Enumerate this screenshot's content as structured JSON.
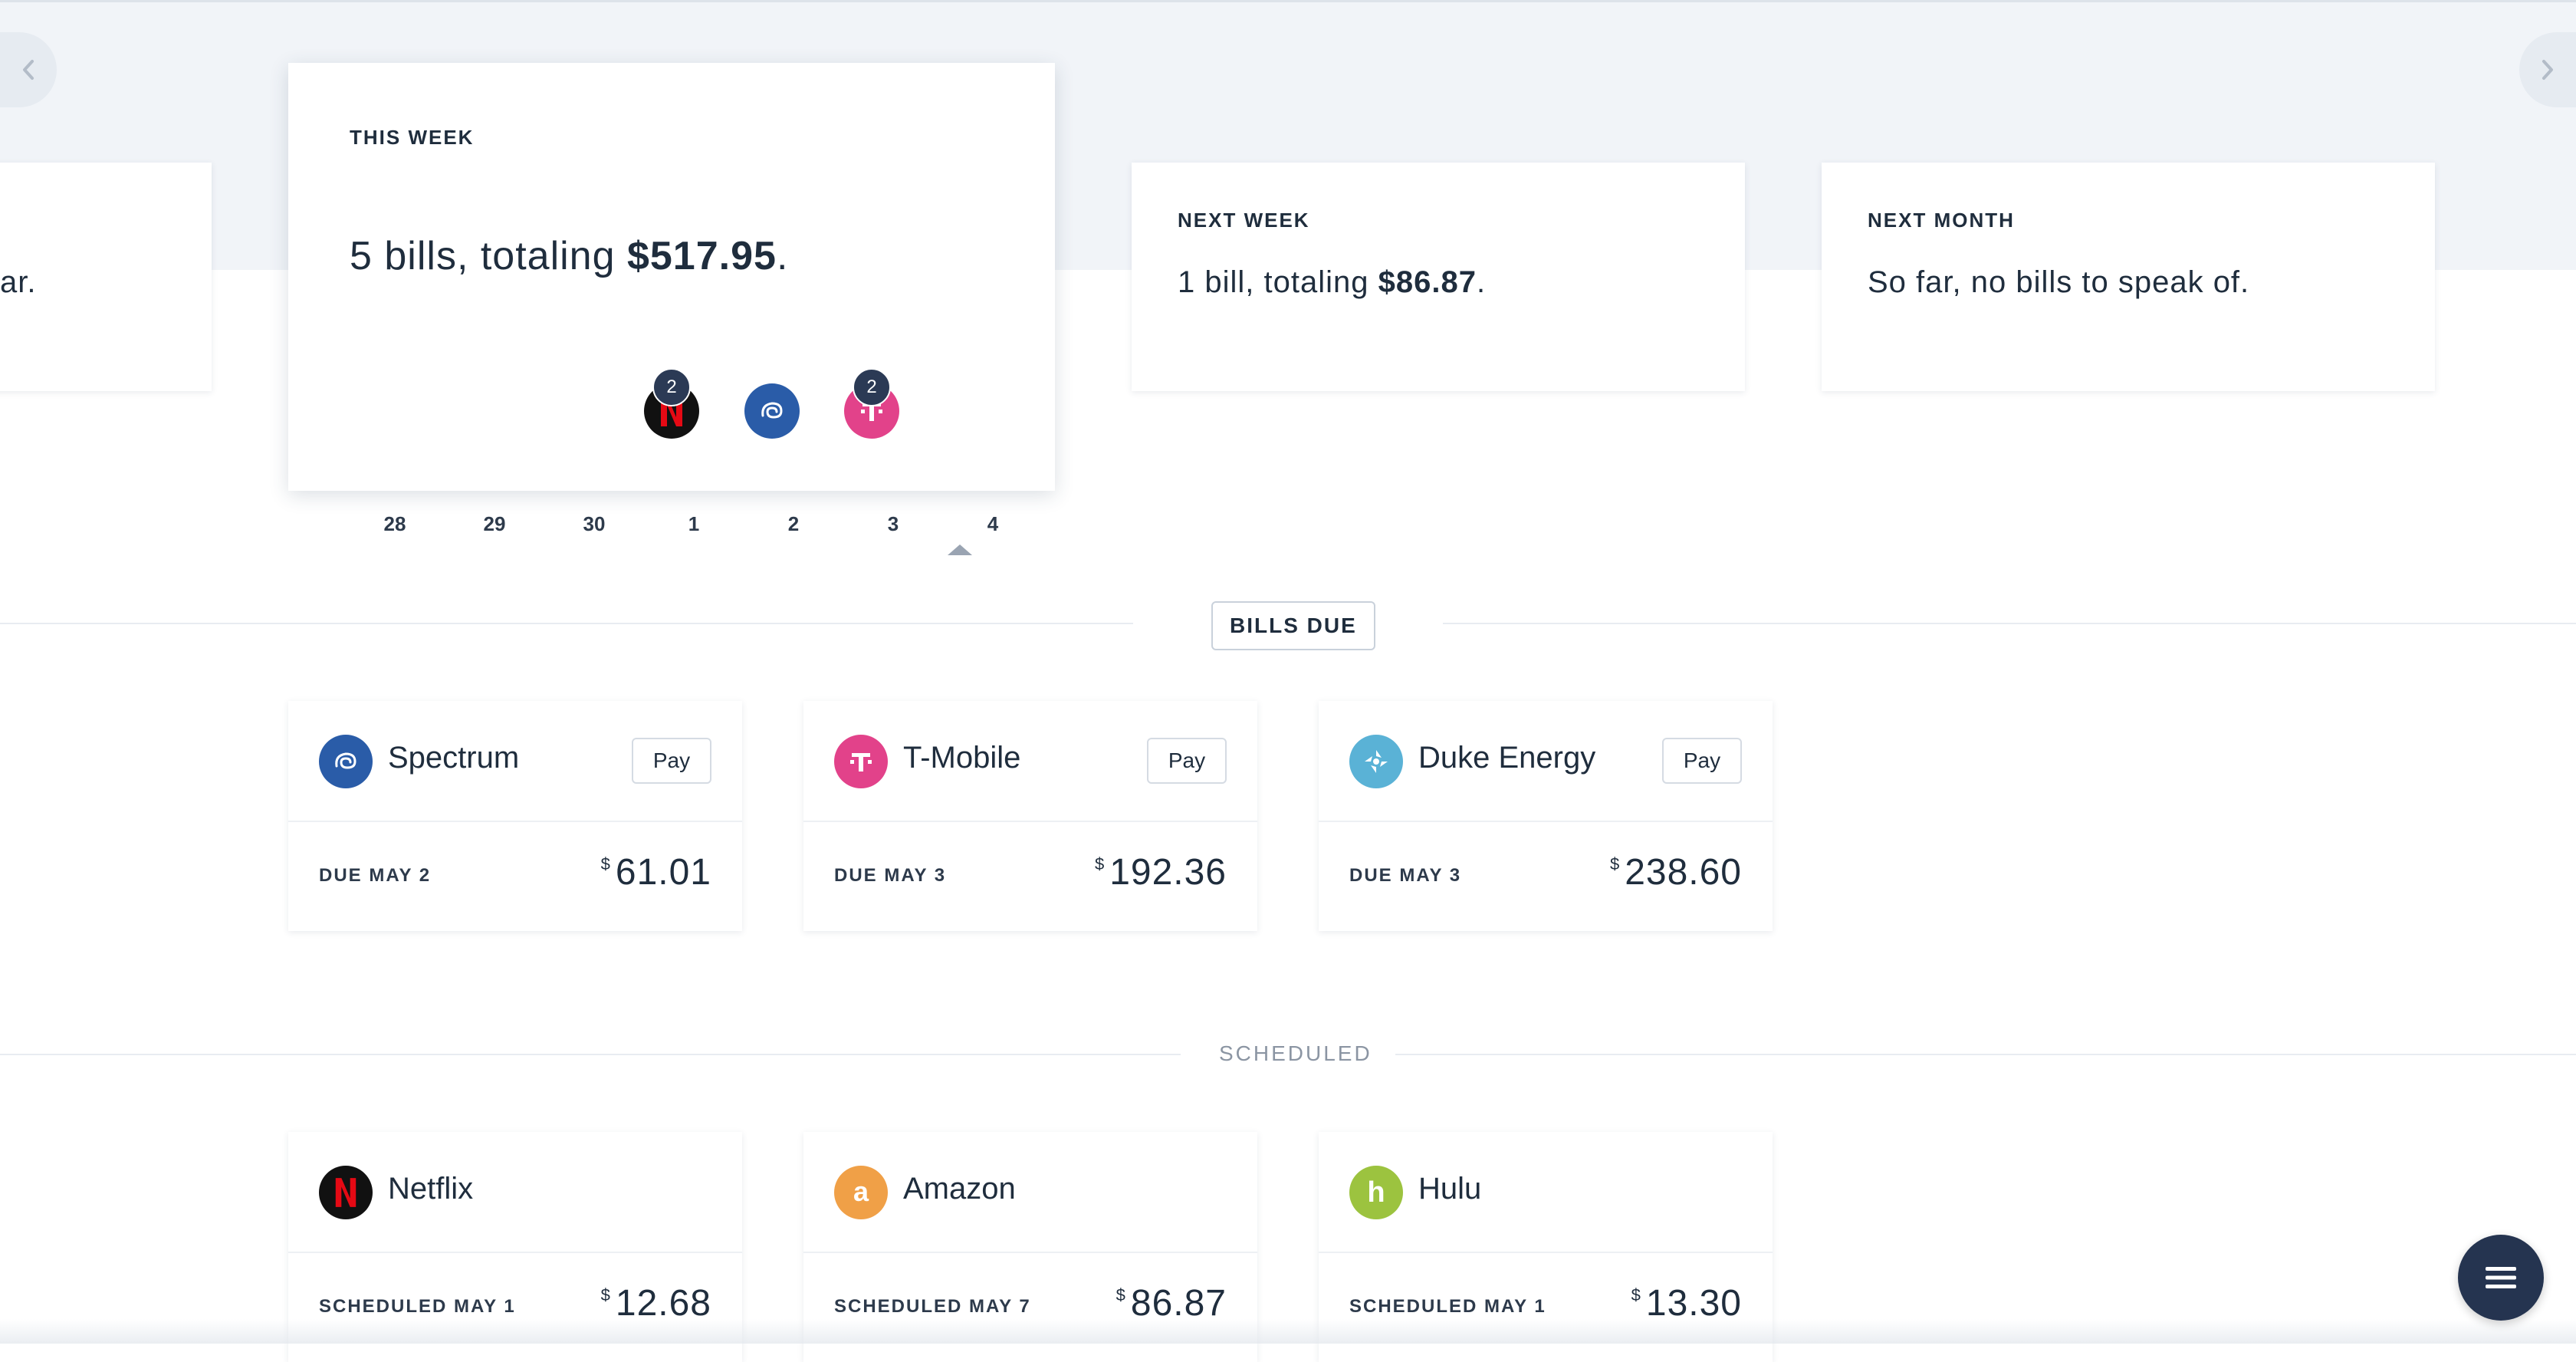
{
  "nav": {
    "prev_icon": "chevron-left-icon",
    "next_icon": "chevron-right-icon"
  },
  "prev_period": {
    "summary_fragment": "ar."
  },
  "this_week": {
    "label": "THIS WEEK",
    "summary_prefix": "5 bills, totaling ",
    "total": "$517.95",
    "summary_suffix": ".",
    "days": [
      "28",
      "29",
      "30",
      "1",
      "2",
      "3",
      "4"
    ],
    "markers": [
      {
        "day": "1",
        "icon": "netflix-icon",
        "count": "2"
      },
      {
        "day": "2",
        "icon": "spectrum-icon",
        "count": ""
      },
      {
        "day": "3",
        "icon": "t-mobile-icon",
        "count": "2"
      }
    ]
  },
  "next_week": {
    "label": "NEXT WEEK",
    "summary_prefix": "1 bill, totaling ",
    "total": "$86.87",
    "summary_suffix": "."
  },
  "next_month": {
    "label": "NEXT MONTH",
    "summary": "So far, no bills to speak of."
  },
  "bills_due": {
    "heading": "BILLS DUE",
    "items": [
      {
        "name": "Spectrum",
        "pay_label": "Pay",
        "due": "DUE MAY 2",
        "currency": "$",
        "amount": "61.01",
        "color": "#2a5ca8"
      },
      {
        "name": "T-Mobile",
        "pay_label": "Pay",
        "due": "DUE MAY 3",
        "currency": "$",
        "amount": "192.36",
        "color": "#e2428a"
      },
      {
        "name": "Duke Energy",
        "pay_label": "Pay",
        "due": "DUE MAY 3",
        "currency": "$",
        "amount": "238.60",
        "color": "#5ab2d6"
      }
    ]
  },
  "scheduled": {
    "heading": "SCHEDULED",
    "items": [
      {
        "name": "Netflix",
        "due": "SCHEDULED MAY 1",
        "currency": "$",
        "amount": "12.68",
        "color": "#111111"
      },
      {
        "name": "Amazon",
        "due": "SCHEDULED MAY 7",
        "currency": "$",
        "amount": "86.87",
        "color": "#f0a047"
      },
      {
        "name": "Hulu",
        "due": "SCHEDULED MAY 1",
        "currency": "$",
        "amount": "13.30",
        "color": "#9cc33f"
      }
    ]
  },
  "menu": {
    "icon": "menu-icon"
  }
}
